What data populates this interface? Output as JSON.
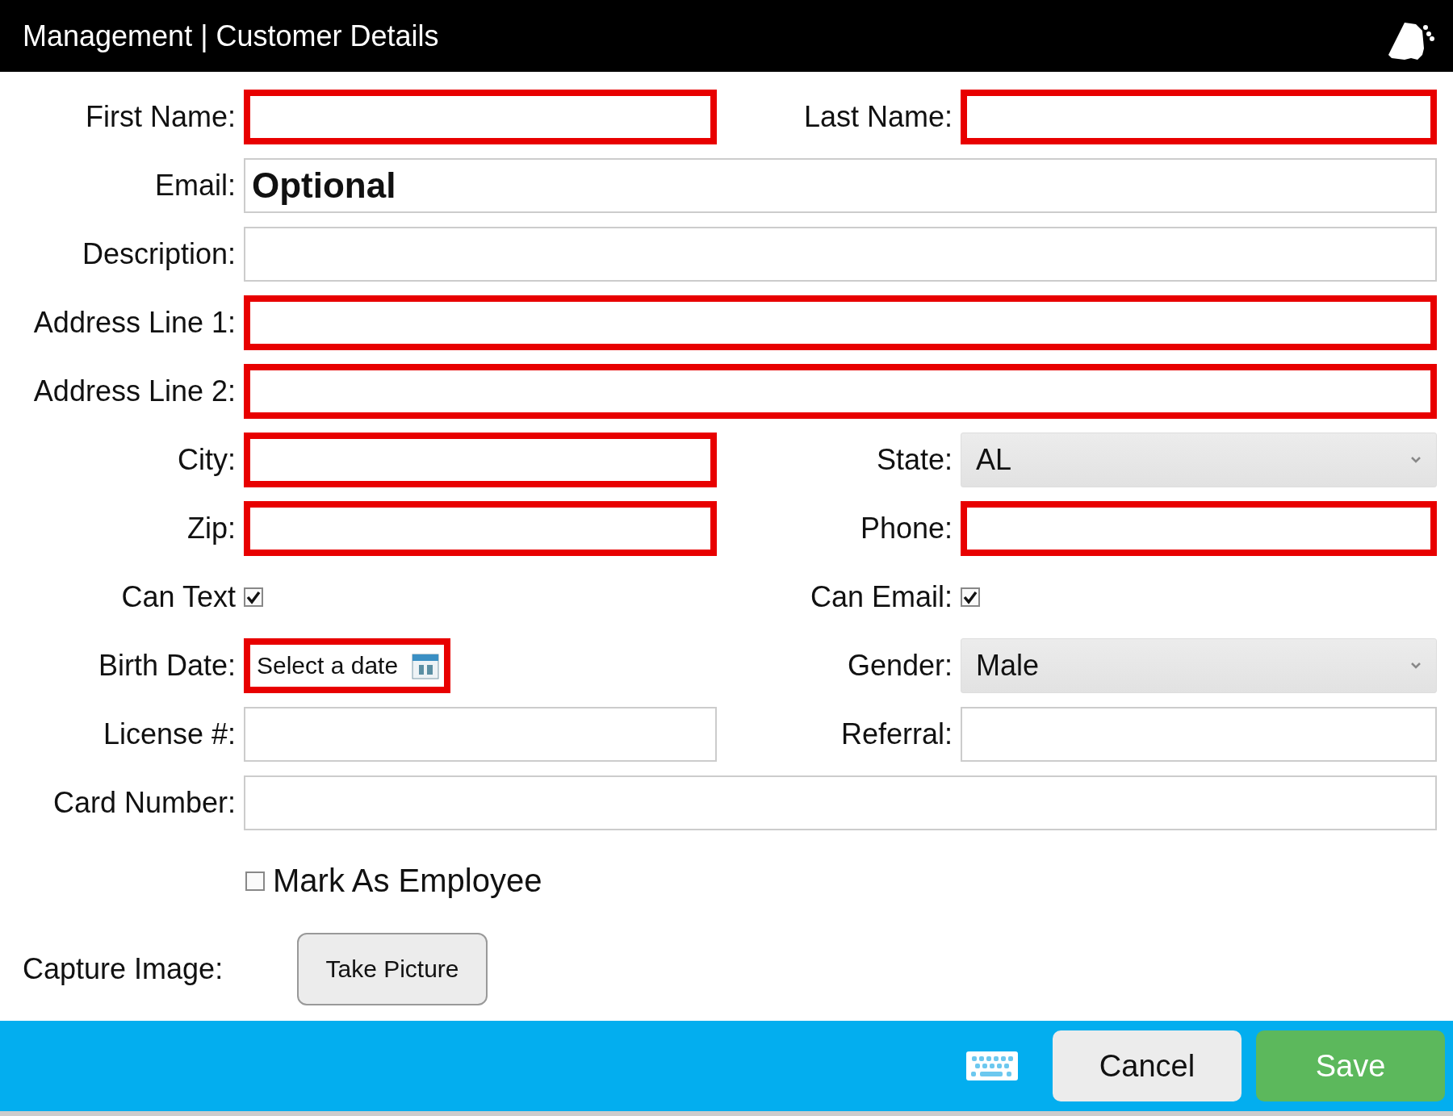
{
  "header": {
    "title": "Management | Customer Details"
  },
  "rows": [
    [
      {
        "label": "First Name:",
        "kind": "text",
        "required": true
      },
      {
        "label": "Last Name:",
        "kind": "text",
        "required": true
      }
    ],
    [
      {
        "label": "Email:",
        "kind": "text",
        "required": false,
        "placeholder": "Optional"
      }
    ],
    [
      {
        "label": "Description:",
        "kind": "text",
        "required": false
      }
    ],
    [
      {
        "label": "Address Line 1:",
        "kind": "text",
        "required": true
      }
    ],
    [
      {
        "label": "Address Line 2:",
        "kind": "text",
        "required": true
      }
    ],
    [
      {
        "label": "City:",
        "kind": "text",
        "required": true
      },
      {
        "label": "State:",
        "kind": "select",
        "required": false,
        "value": "AL"
      }
    ],
    [
      {
        "label": "Zip:",
        "kind": "text",
        "required": true
      },
      {
        "label": "Phone:",
        "kind": "text",
        "required": true
      }
    ],
    [
      {
        "label": "Can Text",
        "kind": "checkbox",
        "checked": true
      },
      {
        "label": "Can Email:",
        "kind": "checkbox",
        "checked": true
      }
    ],
    [
      {
        "label": "Birth Date:",
        "kind": "date",
        "required": true,
        "placeholder": "Select a date"
      },
      {
        "label": "Gender:",
        "kind": "select",
        "required": false,
        "value": "Male"
      }
    ],
    [
      {
        "label": "License #:",
        "kind": "text",
        "required": false
      },
      {
        "label": "Referral:",
        "kind": "text",
        "required": false
      }
    ],
    [
      {
        "label": "Card Number:",
        "kind": "text",
        "required": false
      }
    ]
  ],
  "employee": {
    "label": "Mark As Employee",
    "checked": false
  },
  "capture": {
    "label": "Capture Image:",
    "button": "Take Picture"
  },
  "footer": {
    "buttons": [
      {
        "label": "Cancel",
        "kind": "secondary"
      },
      {
        "label": "Save",
        "kind": "primary"
      }
    ]
  }
}
